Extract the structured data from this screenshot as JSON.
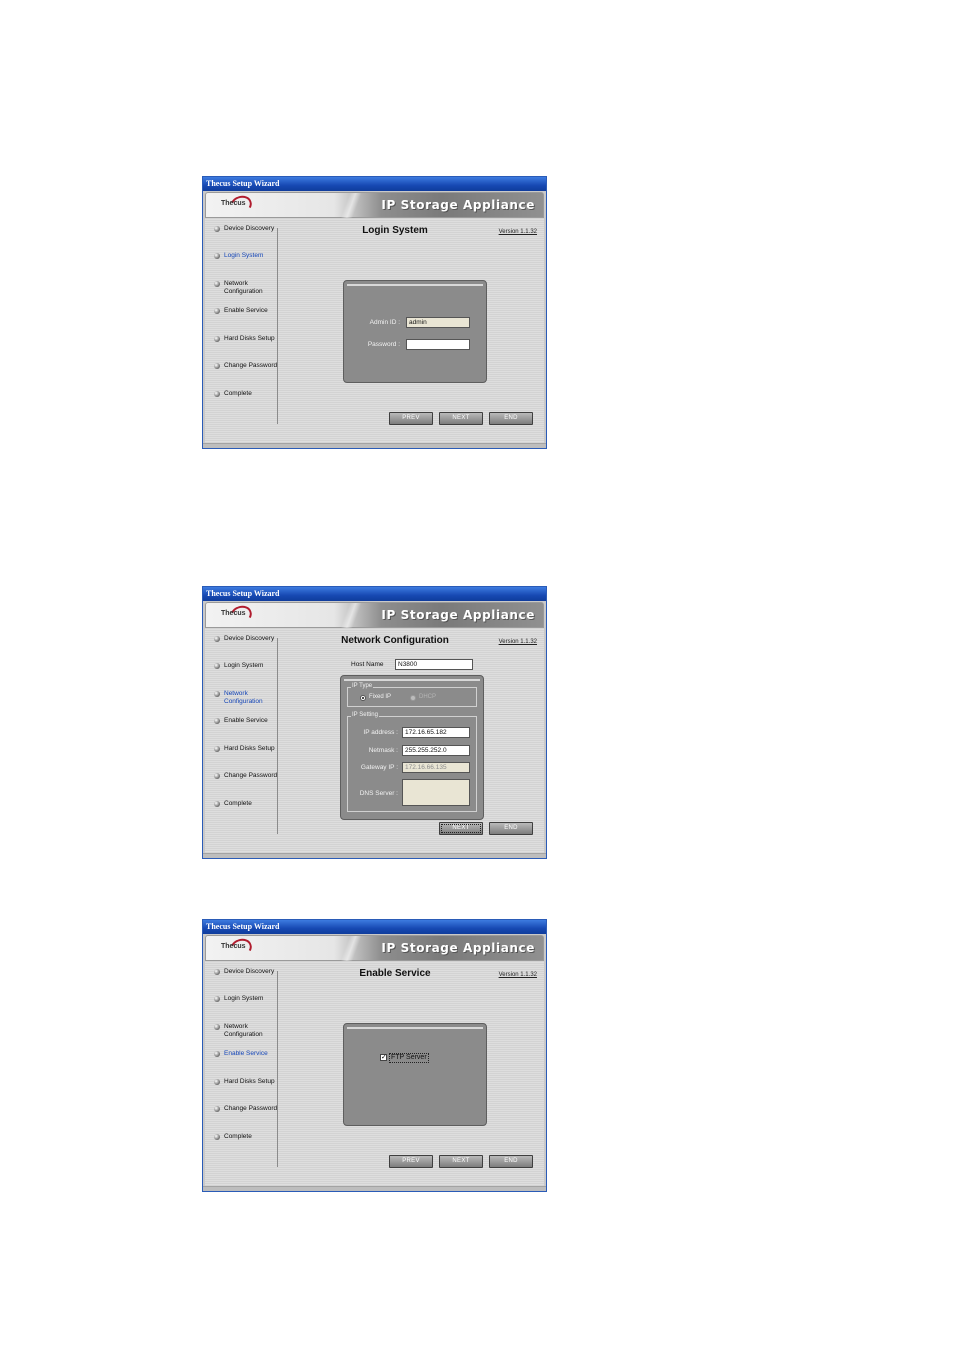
{
  "window": {
    "title": "Thecus Setup Wizard",
    "logo_text": "Thecus",
    "brand": "IP Storage Appliance",
    "version": "Version 1.1.32"
  },
  "icons": {
    "logo": "thecus-logo-icon",
    "bullet": "bullet-ball-icon",
    "check": "checkmark-icon"
  },
  "steps": [
    "Device Discovery",
    "Login System",
    "Network Configuration",
    "Enable Service",
    "Hard Disks Setup",
    "Change Password",
    "Complete"
  ],
  "buttons": {
    "prev": "PREV",
    "next": "NEXT",
    "end": "END"
  },
  "login": {
    "title": "Login System",
    "active_step": "Login System",
    "admin_label": "Admin ID :",
    "admin_value": "admin",
    "password_label": "Password :",
    "password_value": ""
  },
  "network": {
    "title": "Network Configuration",
    "active_step": "Network Configuration",
    "host_label": "Host Name",
    "host_value": "N3800",
    "ip_type_label": "IP Type",
    "fixed_ip_label": "Fixed IP",
    "dhcp_label": "DHCP",
    "selected_ip_type": "Fixed IP",
    "ip_setting_label": "IP Setting",
    "ip_address_label": "IP address :",
    "ip_address_value": "172.16.65.182",
    "netmask_label": "Netmask :",
    "netmask_value": "255.255.252.0",
    "gateway_label": "Gateway IP :",
    "gateway_value": "172.16.66.135",
    "dns_label": "DNS Server :",
    "dns_value": ""
  },
  "service": {
    "title": "Enable Service",
    "active_step": "Enable Service",
    "ftp_label": "FTP Server",
    "ftp_checked": true
  }
}
